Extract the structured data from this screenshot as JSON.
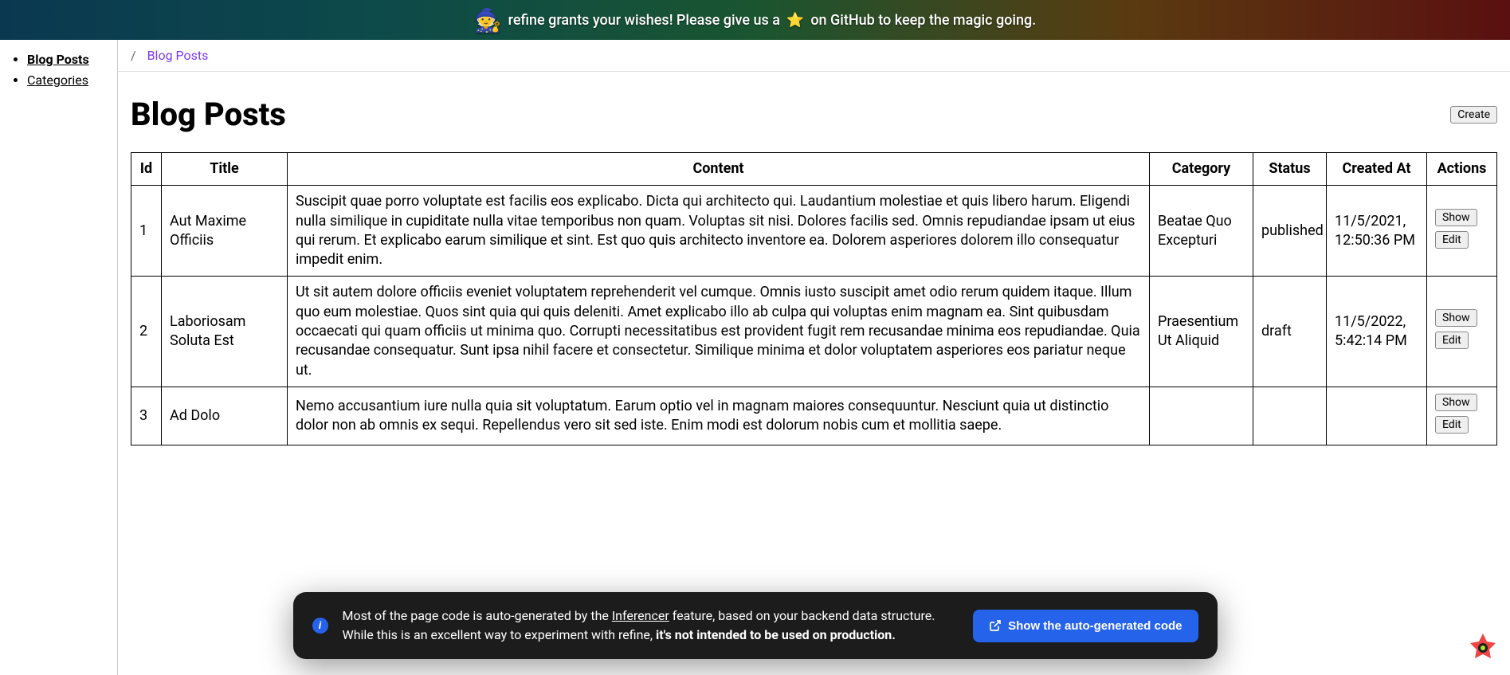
{
  "banner": {
    "text_before": "refine grants your wishes! Please give us a",
    "text_after": "on GitHub to keep the magic going."
  },
  "sidebar": {
    "items": [
      {
        "label": "Blog Posts",
        "active": true
      },
      {
        "label": "Categories",
        "active": false
      }
    ]
  },
  "breadcrumb": {
    "separator": "/",
    "current": "Blog Posts"
  },
  "page": {
    "title": "Blog Posts",
    "create_label": "Create"
  },
  "table": {
    "headers": {
      "id": "Id",
      "title": "Title",
      "content": "Content",
      "category": "Category",
      "status": "Status",
      "created_at": "Created At",
      "actions": "Actions"
    },
    "action_labels": {
      "show": "Show",
      "edit": "Edit"
    },
    "rows": [
      {
        "id": "1",
        "title": "Aut Maxime Officiis",
        "content": "Suscipit quae porro voluptate est facilis eos explicabo. Dicta qui architecto qui. Laudantium molestiae et quis libero harum. Eligendi nulla similique in cupiditate nulla vitae temporibus non quam. Voluptas sit nisi. Dolores facilis sed. Omnis repudiandae ipsam ut eius qui rerum. Et explicabo earum similique et sint. Est quo quis architecto inventore ea. Dolorem asperiores dolorem illo consequatur impedit enim.",
        "category": "Beatae Quo Excepturi",
        "status": "published",
        "created_at": "11/5/2021, 12:50:36 PM"
      },
      {
        "id": "2",
        "title": "Laboriosam Soluta Est",
        "content": "Ut sit autem dolore officiis eveniet voluptatem reprehenderit vel cumque. Omnis iusto suscipit amet odio rerum quidem itaque. Illum quo eum molestiae. Quos sint quia qui quis deleniti. Amet explicabo illo ab culpa qui voluptas enim magnam ea. Sint quibusdam occaecati qui quam officiis ut minima quo. Corrupti necessitatibus est provident fugit rem recusandae minima eos repudiandae. Quia recusandae consequatur. Sunt ipsa nihil facere et consectetur. Similique minima et dolor voluptatem asperiores eos pariatur neque ut.",
        "category": "Praesentium Ut Aliquid",
        "status": "draft",
        "created_at": "11/5/2022, 5:42:14 PM"
      },
      {
        "id": "3",
        "title": "Ad Dolo",
        "content": "Nemo accusantium iure nulla quia sit voluptatum. Earum optio vel in magnam maiores consequuntur. Nesciunt quia ut distinctio dolor non ab omnis ex sequi. Repellendus vero sit sed iste. Enim modi est dolorum nobis cum et mollitia saepe.",
        "category": "",
        "status": "",
        "created_at": ""
      }
    ]
  },
  "toast": {
    "text_before": "Most of the page code is auto-generated by the ",
    "link_label": "Inferencer",
    "text_mid": " feature, based on your backend data structure. While this is an excellent way to experiment with refine, ",
    "text_strong": "it's not intended to be used on production.",
    "button_label": "Show the auto-generated code"
  }
}
